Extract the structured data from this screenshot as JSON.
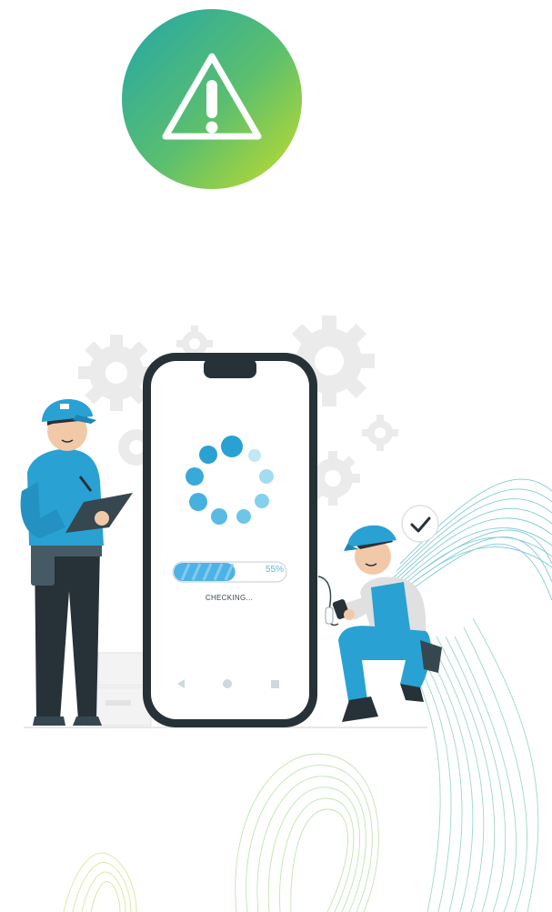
{
  "progress": {
    "percent_label": "55%",
    "fraction": 0.55,
    "status_label": "CHECKING..."
  },
  "colors": {
    "badge_gradient_start": "#22a6a8",
    "badge_gradient_end": "#c6dd2a",
    "phone_frame": "#263238",
    "accent_blue": "#2aa1d3",
    "progress_fill": "#4db3e6",
    "gear_gray": "#ebebeb",
    "wave_teal": "#5ab8c4",
    "wave_green": "#a8d48e"
  },
  "icons": {
    "badge": "warning-triangle-icon",
    "spinner": "loading-spinner-icon",
    "check": "checkmark-icon",
    "nav_back": "back-triangle-icon",
    "nav_home": "home-circle-icon",
    "nav_recent": "recent-square-icon"
  }
}
